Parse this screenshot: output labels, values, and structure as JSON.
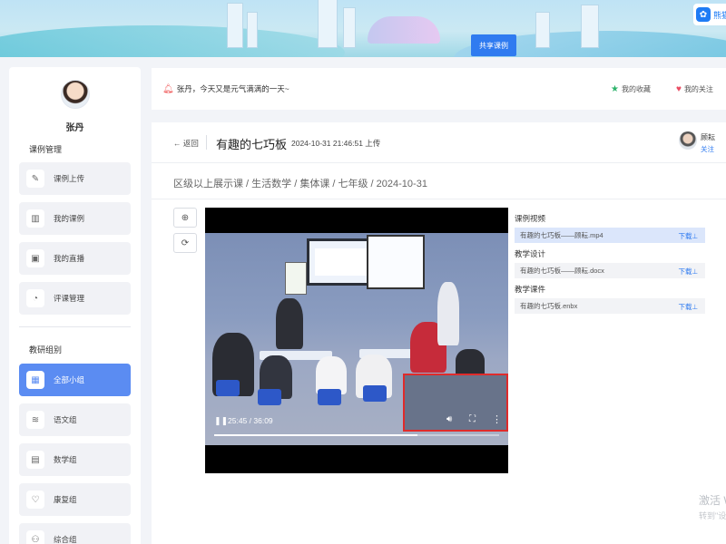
{
  "banner": {
    "share_label": "共享课例",
    "brand": "熊猫"
  },
  "sidebar": {
    "user_name": "张丹",
    "section_course": "课例管理",
    "course_items": [
      {
        "label": "课例上传",
        "icon": "upload-icon"
      },
      {
        "label": "我的课例",
        "icon": "book-icon"
      },
      {
        "label": "我的直播",
        "icon": "live-icon"
      },
      {
        "label": "评课管理",
        "icon": "review-icon"
      }
    ],
    "section_group": "教研组别",
    "group_items": [
      {
        "label": "全部小组",
        "icon": "grid-icon",
        "active": true
      },
      {
        "label": "语文组",
        "icon": "layers-icon"
      },
      {
        "label": "数学组",
        "icon": "calculator-icon"
      },
      {
        "label": "康复组",
        "icon": "heart-shield-icon"
      },
      {
        "label": "综合组",
        "icon": "people-icon"
      }
    ]
  },
  "greeting": "张丹，今天又是元气满满的一天~",
  "top_links": {
    "favorites": "我的收藏",
    "follows": "我的关注"
  },
  "course": {
    "back_label": "返回",
    "title": "有趣的七巧板",
    "upload_time": "2024-10-31 21:46:51 上传",
    "teacher_name": "顾耘",
    "follow_label": "关注",
    "breadcrumb": "区级以上展示课 / 生活数学 / 集体课 / 七年级 / 2024-10-31"
  },
  "video": {
    "current": "25:45",
    "duration": "36:09",
    "progress": 0.712
  },
  "resources": {
    "video_title": "课例视频",
    "video_files": [
      {
        "name": "有趣的七巧板——顾耘.mp4",
        "action": "下载⊥"
      }
    ],
    "design_title": "教学设计",
    "design_files": [
      {
        "name": "有趣的七巧板——顾耘.docx",
        "action": "下载⊥"
      }
    ],
    "courseware_title": "教学课件",
    "courseware_files": [
      {
        "name": "有趣的七巧板.enbx",
        "action": "下载⊥"
      }
    ]
  },
  "watermark": {
    "line1": "激活 W",
    "line2": "转到\"设置"
  }
}
